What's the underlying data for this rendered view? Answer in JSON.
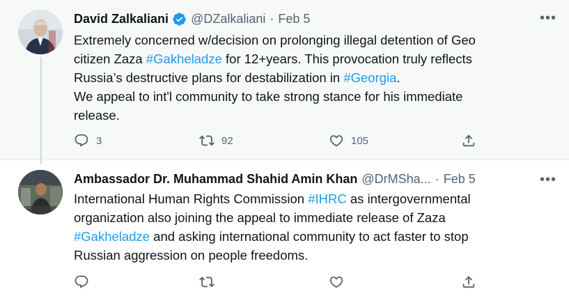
{
  "tweets": [
    {
      "author_name": "David Zalkaliani",
      "handle": "@DZalkaliani",
      "date": "Feb 5",
      "more_label": "•••",
      "lines": [
        [
          {
            "t": "Extremely concerned w/decision on prolonging illegal detention of Geo"
          }
        ],
        [
          {
            "t": "citizen Zaza "
          },
          {
            "t": "#Gakheladze",
            "tag": true
          },
          {
            "t": " for 12+years. This provocation truly reflects"
          }
        ],
        [
          {
            "t": "Russia’s destructive plans for destabilization in "
          },
          {
            "t": "#Georgia",
            "tag": true
          },
          {
            "t": "."
          }
        ],
        [
          {
            "t": "We appeal to int'l community to take strong stance for his immediate"
          }
        ],
        [
          {
            "t": "release."
          }
        ]
      ],
      "reply_count": "3",
      "retweet_count": "92",
      "like_count": "105"
    },
    {
      "author_name": "Ambassador Dr. Muhammad Shahid Amin Khan",
      "handle": "@DrMSha...",
      "date": "Feb 5",
      "more_label": "•••",
      "lines": [
        [
          {
            "t": "International Human Rights Commission "
          },
          {
            "t": "#IHRC",
            "tag": true
          },
          {
            "t": " as intergovernmental"
          }
        ],
        [
          {
            "t": "organization also joining the appeal to immediate release of Zaza"
          }
        ],
        [
          {
            "t": "#Gakheladze",
            "tag": true
          },
          {
            "t": " and asking international community to act faster to stop"
          }
        ],
        [
          {
            "t": "Russian aggression on people freedoms."
          }
        ]
      ],
      "reply_count": "",
      "retweet_count": "",
      "like_count": ""
    }
  ],
  "colors": {
    "hashtag": "#1d9bf0",
    "secondary_text": "#536471",
    "verified_badge": "#1d9bf0",
    "highlight_background": "#f7f9f9"
  },
  "icons": {
    "reply": "reply-icon",
    "retweet": "retweet-icon",
    "like": "like-icon",
    "share": "share-icon",
    "verified": "verified-badge-icon",
    "more": "more-options-icon"
  }
}
